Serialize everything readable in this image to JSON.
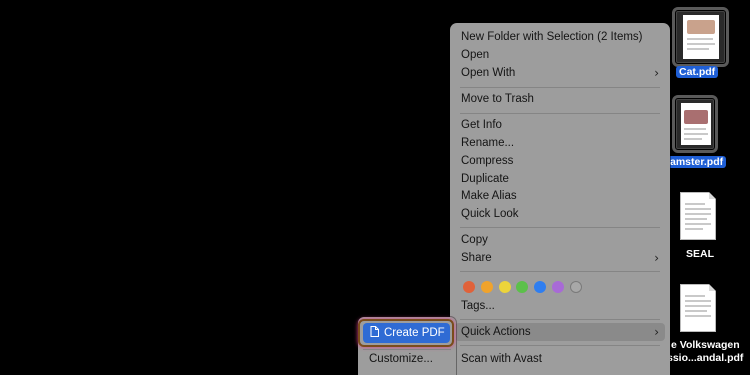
{
  "menu": {
    "items": [
      {
        "label": "New Folder with Selection (2 Items)"
      },
      {
        "label": "Open"
      },
      {
        "label": "Open With"
      },
      {
        "label": "Move to Trash"
      },
      {
        "label": "Get Info"
      },
      {
        "label": "Rename..."
      },
      {
        "label": "Compress"
      },
      {
        "label": "Duplicate"
      },
      {
        "label": "Make Alias"
      },
      {
        "label": "Quick Look"
      },
      {
        "label": "Copy"
      },
      {
        "label": "Share"
      },
      {
        "label": "Tags..."
      },
      {
        "label": "Quick Actions"
      },
      {
        "label": "Scan with Avast"
      }
    ],
    "chevron": "›",
    "tag_colors": [
      "#e0623a",
      "#f0a32c",
      "#ecd43a",
      "#5cc04a",
      "#2f7ef0",
      "#a86ad6",
      "#a8a8a8"
    ]
  },
  "submenu": {
    "create_pdf": "Create PDF",
    "customize": "Customize...",
    "document_icon": "document-icon"
  },
  "desktop": {
    "files": [
      {
        "label": "Cat.pdf",
        "selected": true
      },
      {
        "label": "amster.pdf",
        "selected": true
      },
      {
        "label": "SEAL",
        "selected": false
      },
      {
        "label_line1": "e Volkswagen",
        "label_line2": "ssio...andal.pdf",
        "selected": false
      }
    ]
  }
}
